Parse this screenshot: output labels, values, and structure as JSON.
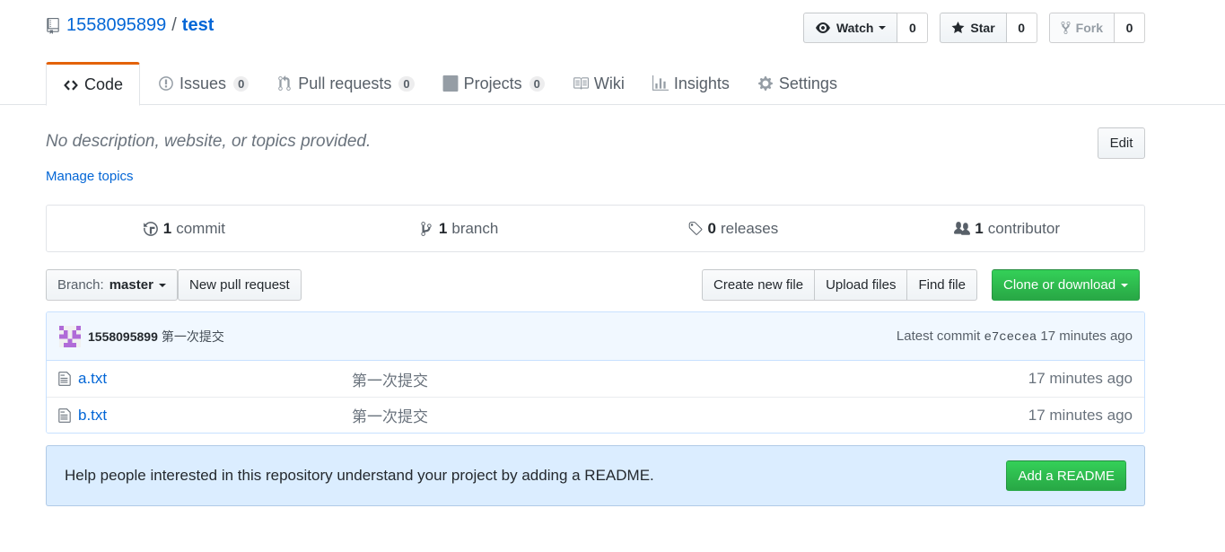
{
  "repo": {
    "owner": "1558095899",
    "separator": "/",
    "name": "test"
  },
  "actions": {
    "watch": {
      "label": "Watch",
      "count": "0"
    },
    "star": {
      "label": "Star",
      "count": "0"
    },
    "fork": {
      "label": "Fork",
      "count": "0"
    }
  },
  "nav": {
    "code": "Code",
    "issues": {
      "label": "Issues",
      "count": "0"
    },
    "pulls": {
      "label": "Pull requests",
      "count": "0"
    },
    "projects": {
      "label": "Projects",
      "count": "0"
    },
    "wiki": "Wiki",
    "insights": "Insights",
    "settings": "Settings"
  },
  "description": {
    "text": "No description, website, or topics provided.",
    "manage_topics": "Manage topics",
    "edit": "Edit"
  },
  "summary": {
    "commits": {
      "num": "1",
      "label": "commit"
    },
    "branches": {
      "num": "1",
      "label": "branch"
    },
    "releases": {
      "num": "0",
      "label": "releases"
    },
    "contributors": {
      "num": "1",
      "label": "contributor"
    }
  },
  "file_nav": {
    "branch_prefix": "Branch:",
    "branch_name": "master",
    "new_pull_request": "New pull request",
    "create_new_file": "Create new file",
    "upload_files": "Upload files",
    "find_file": "Find file",
    "clone_or_download": "Clone or download"
  },
  "commit_tease": {
    "author": "1558095899",
    "message": "第一次提交",
    "latest_prefix": "Latest commit",
    "sha": "e7cecea",
    "age": "17 minutes ago"
  },
  "files": [
    {
      "name": "a.txt",
      "message": "第一次提交",
      "age": "17 minutes ago"
    },
    {
      "name": "b.txt",
      "message": "第一次提交",
      "age": "17 minutes ago"
    }
  ],
  "readme_prompt": {
    "text": "Help people interested in this repository understand your project by adding a README.",
    "button": "Add a README"
  },
  "colors": {
    "accent_orange": "#e36209",
    "link_blue": "#0366d6",
    "green_button": "#28a745",
    "flash_blue": "#dbedff"
  }
}
